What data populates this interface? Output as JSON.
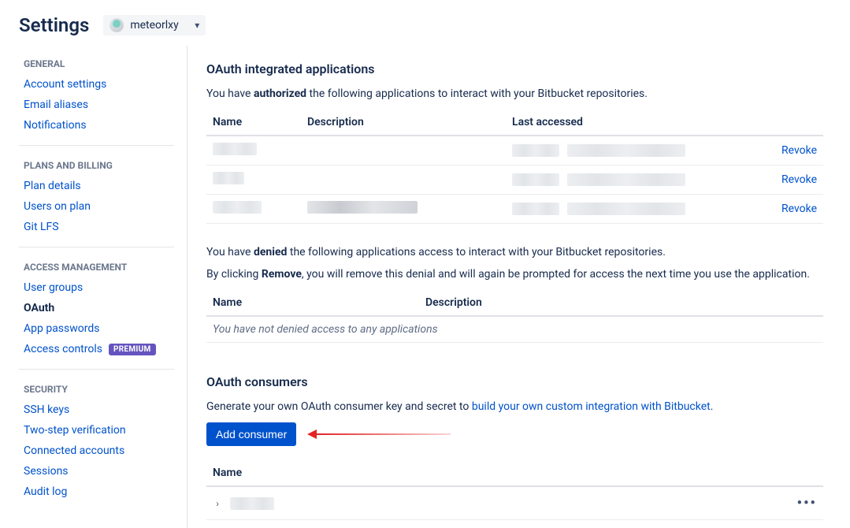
{
  "header": {
    "title": "Settings",
    "workspace_name": "meteorlxy"
  },
  "sidebar": {
    "sections": [
      {
        "heading": "GENERAL",
        "items": [
          "Account settings",
          "Email aliases",
          "Notifications"
        ]
      },
      {
        "heading": "PLANS AND BILLING",
        "items": [
          "Plan details",
          "Users on plan",
          "Git LFS"
        ]
      },
      {
        "heading": "ACCESS MANAGEMENT",
        "items": [
          "User groups",
          "OAuth",
          "App passwords",
          "Access controls"
        ],
        "premium_index": 3,
        "active_index": 1
      },
      {
        "heading": "SECURITY",
        "items": [
          "SSH keys",
          "Two-step verification",
          "Connected accounts",
          "Sessions",
          "Audit log"
        ]
      }
    ],
    "premium_label": "PREMIUM"
  },
  "oauth_apps": {
    "title": "OAuth integrated applications",
    "authorized_line_before": "You have ",
    "authorized_strong": "authorized",
    "authorized_line_after": " the following applications to interact with your Bitbucket repositories.",
    "columns": {
      "name": "Name",
      "description": "Description",
      "last": "Last accessed"
    },
    "revoke_label": "Revoke",
    "denied_line_before": "You have ",
    "denied_strong": "denied",
    "denied_line_after": " the following applications access to interact with your Bitbucket repositories.",
    "remove_line_before": "By clicking ",
    "remove_strong": "Remove",
    "remove_line_after": ", you will remove this denial and will again be prompted for access the next time you use the application.",
    "denied_empty": "You have not denied access to any applications"
  },
  "consumers": {
    "title": "OAuth consumers",
    "desc_before": "Generate your own OAuth consumer key and secret to ",
    "desc_link": "build your own custom integration with Bitbucket",
    "desc_after": ".",
    "add_button": "Add consumer",
    "columns": {
      "name": "Name"
    }
  }
}
